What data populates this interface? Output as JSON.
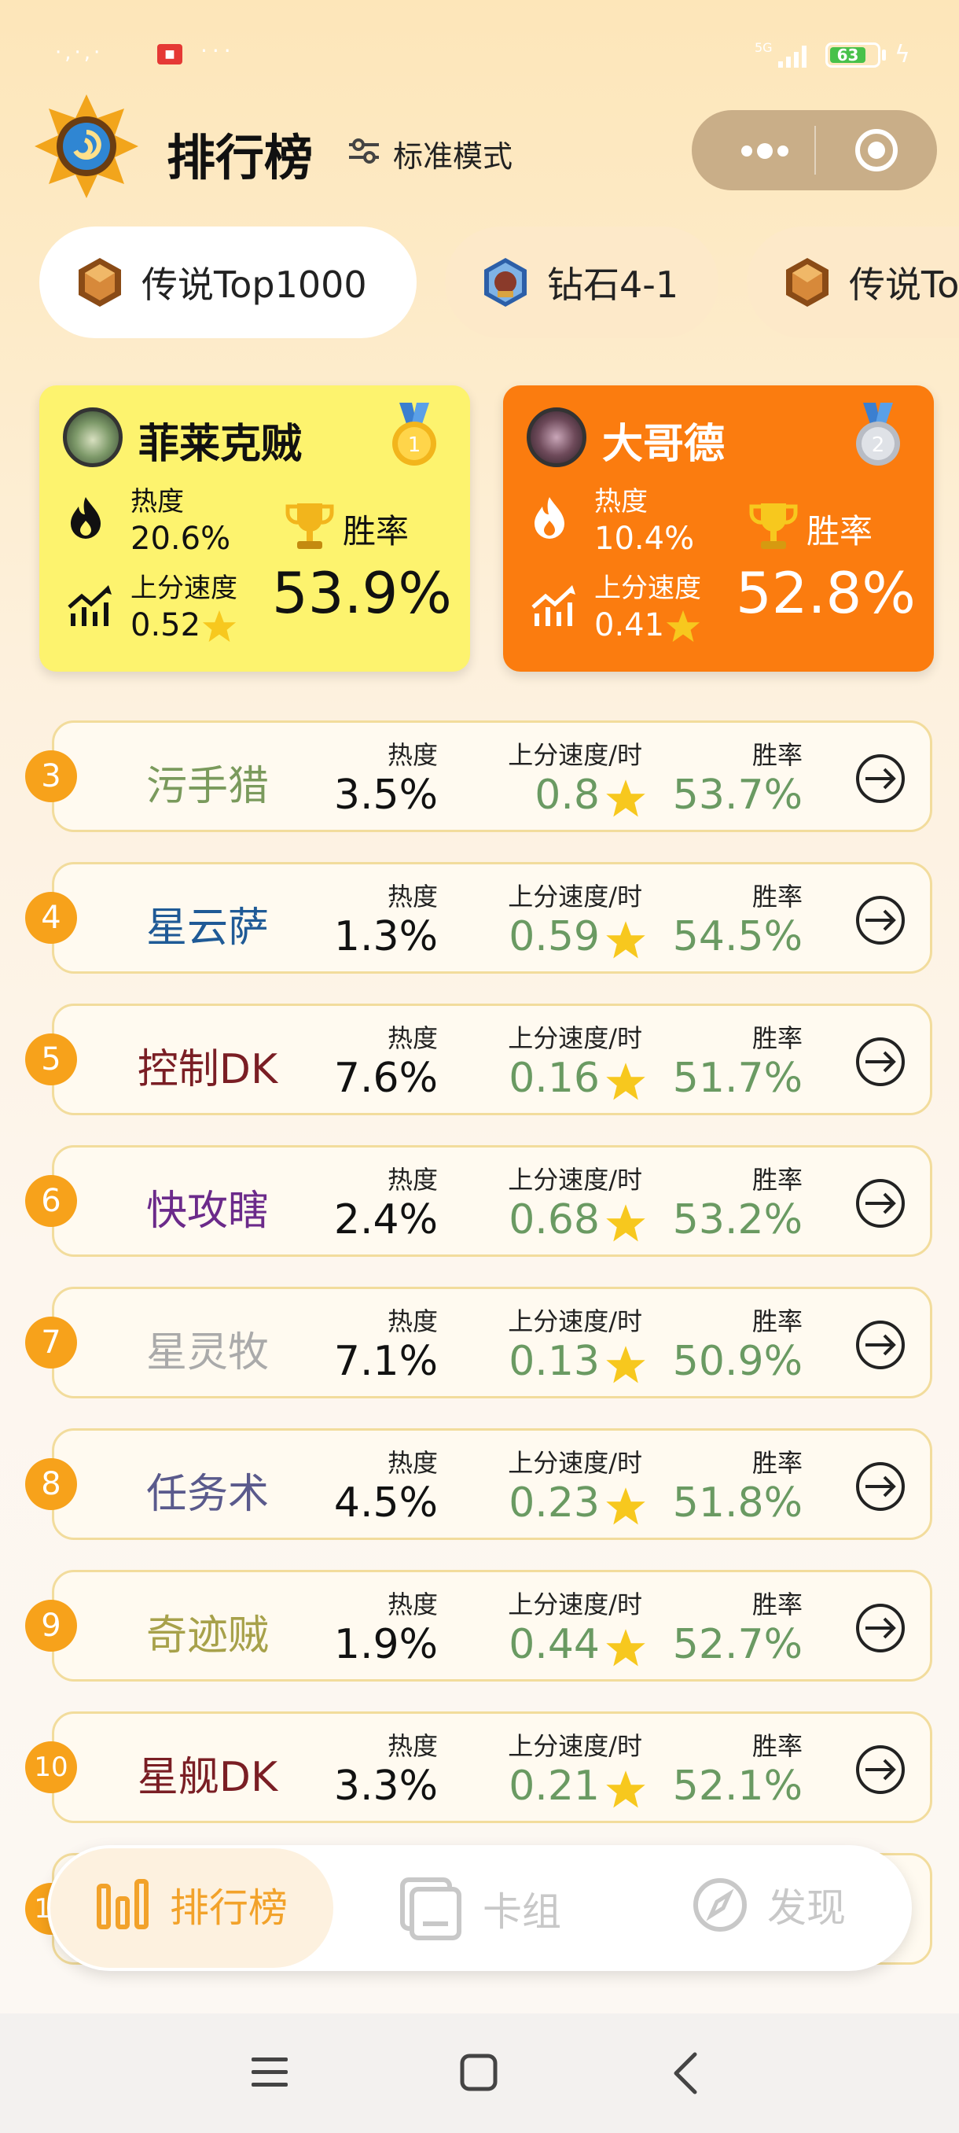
{
  "app": {
    "title": "排行榜",
    "mode_label": "标准模式"
  },
  "status_bar": {
    "left_text": "·,·,·",
    "network": "5G",
    "battery": "63"
  },
  "tabs": [
    {
      "label": "传说Top1000",
      "active": true
    },
    {
      "label": "钻石4-1",
      "active": false
    },
    {
      "label": "传说To",
      "active": false
    }
  ],
  "top_cards": [
    {
      "name": "菲莱克贼",
      "medal": "1",
      "heat_label": "热度",
      "heat": "20.6%",
      "speed_label": "上分速度",
      "speed": "0.52",
      "winrate_label": "胜率",
      "winrate": "53.9%"
    },
    {
      "name": "大哥德",
      "medal": "2",
      "heat_label": "热度",
      "heat": "10.4%",
      "speed_label": "上分速度",
      "speed": "0.41",
      "winrate_label": "胜率",
      "winrate": "52.8%"
    }
  ],
  "list_labels": {
    "heat": "热度",
    "speed": "上分速度/时",
    "winrate": "胜率"
  },
  "rows": [
    {
      "rank": "3",
      "name": "污手猎",
      "name_color": "#7a9a5c",
      "heat": "3.5%",
      "speed": "0.8",
      "winrate": "53.7%"
    },
    {
      "rank": "4",
      "name": "星云萨",
      "name_color": "#1f5a96",
      "heat": "1.3%",
      "speed": "0.59",
      "winrate": "54.5%"
    },
    {
      "rank": "5",
      "name": "控制DK",
      "name_color": "#7a1e24",
      "heat": "7.6%",
      "speed": "0.16",
      "winrate": "51.7%"
    },
    {
      "rank": "6",
      "name": "快攻瞎",
      "name_color": "#6b2a8a",
      "heat": "2.4%",
      "speed": "0.68",
      "winrate": "53.2%"
    },
    {
      "rank": "7",
      "name": "星灵牧",
      "name_color": "#aaaaaa",
      "heat": "7.1%",
      "speed": "0.13",
      "winrate": "50.9%"
    },
    {
      "rank": "8",
      "name": "任务术",
      "name_color": "#5a5a8c",
      "heat": "4.5%",
      "speed": "0.23",
      "winrate": "51.8%"
    },
    {
      "rank": "9",
      "name": "奇迹贼",
      "name_color": "#a7a14a",
      "heat": "1.9%",
      "speed": "0.44",
      "winrate": "52.7%"
    },
    {
      "rank": "10",
      "name": "星舰DK",
      "name_color": "#7a1e24",
      "heat": "3.3%",
      "speed": "0.21",
      "winrate": "52.1%"
    },
    {
      "rank": "11",
      "name": "",
      "name_color": "#7a1e24",
      "heat": "",
      "speed": "",
      "winrate": ""
    }
  ],
  "bottom_nav": [
    {
      "label": "排行榜",
      "icon": "bar-chart-icon",
      "active": true
    },
    {
      "label": "卡组",
      "icon": "deck-icon",
      "active": false
    },
    {
      "label": "发现",
      "icon": "compass-icon",
      "active": false
    }
  ],
  "colors": {
    "accent": "#f7a21b",
    "card1_bg": "#fdf36e",
    "card2_bg": "#fb7c0f",
    "positive_green": "#6a9a62",
    "nav_active": "#f2a22a",
    "nav_inactive": "#c8c8c8"
  },
  "system_nav_icons": [
    "menu-icon",
    "home-square-icon",
    "back-chevron-icon"
  ]
}
